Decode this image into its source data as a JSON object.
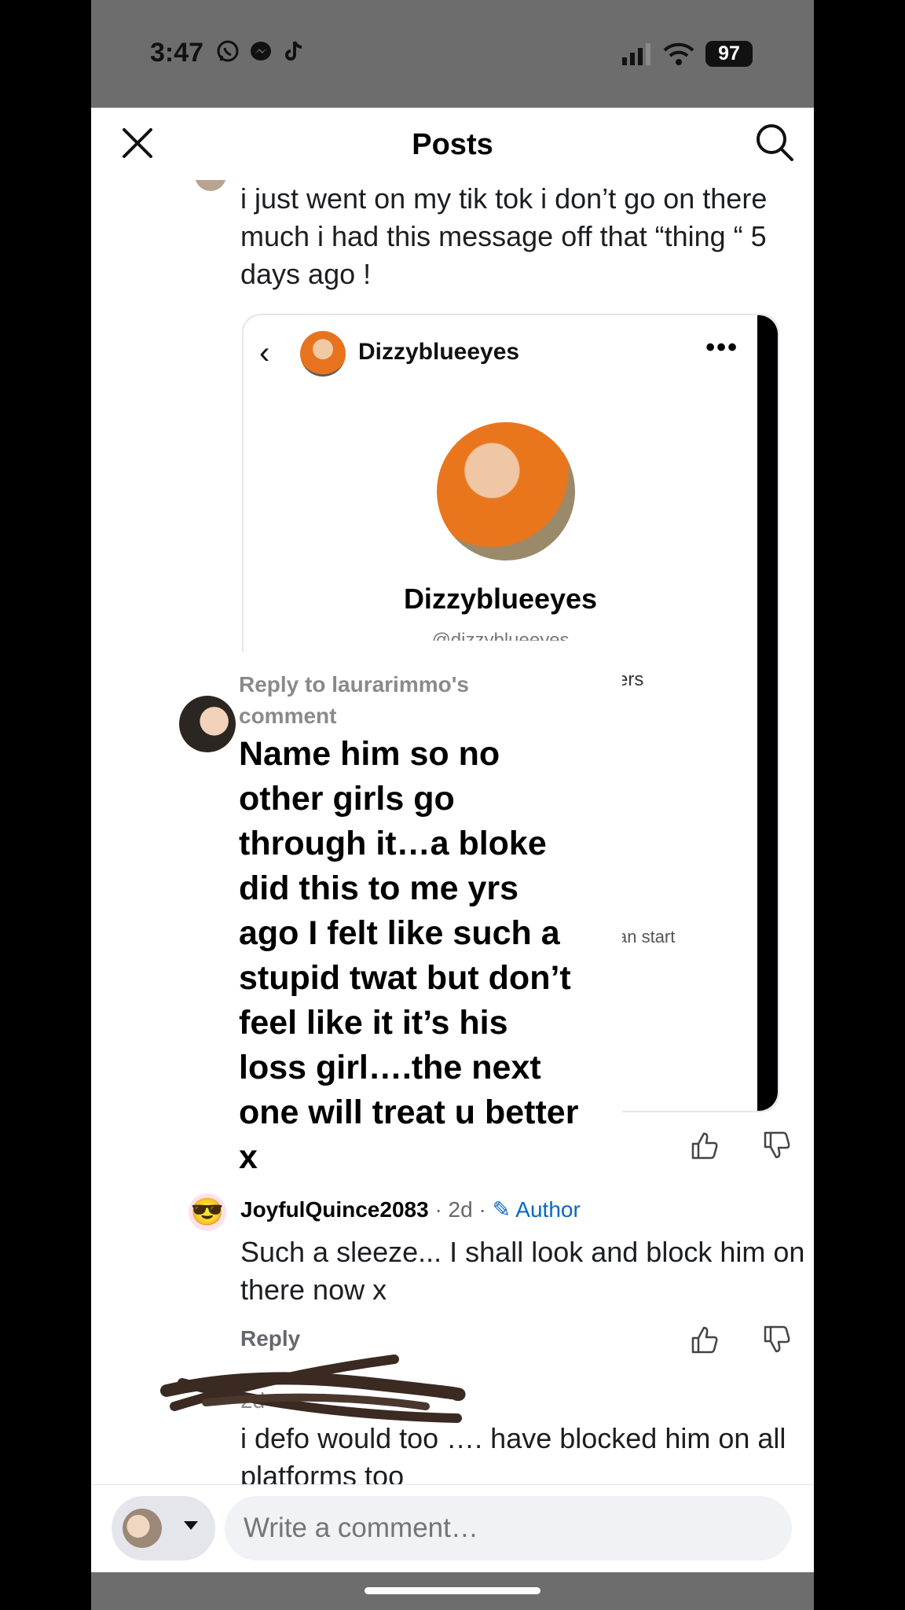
{
  "status_bar": {
    "time": "3:47",
    "battery": "97"
  },
  "header": {
    "title": "Posts"
  },
  "post": {
    "text": "i just went on my tik tok i don’t go on there much i had this message off that “thing “ 5 days ago !",
    "screenshot_card": {
      "username_top": "Dizzyblueeyes",
      "username_big": "Dizzyblueeyes",
      "handle": "@dizzyblueeyes",
      "fragment_followers": "ers",
      "fragment_start": "an start"
    }
  },
  "overlay_comment": {
    "label": "Reply to laurarimmo's comment",
    "text": "Name him so no other girls go through it…a bloke did this to me yrs ago I felt like such a stupid twat but don’t feel like it it’s his loss girl….the next one will treat u better x"
  },
  "reply_comment": {
    "author": "JoyfulQuince2083",
    "age": "2d",
    "badge": "Author",
    "text": "Such a sleeze... I shall look and block him on there now x",
    "reply_label": "Reply"
  },
  "next_comment": {
    "age": "2d",
    "text": "i defo would too …. have blocked him on all platforms too"
  },
  "composer": {
    "placeholder": "Write a comment…"
  }
}
